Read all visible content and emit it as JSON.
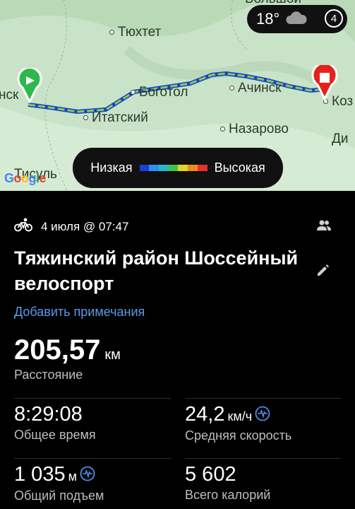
{
  "map": {
    "cities": {
      "tyukhtet": "Тюхтет",
      "bogotol": "Боготол",
      "achinsk": "Ачинск",
      "itatsky": "Итатский",
      "nazarovo": "Назарово",
      "koz": "Коз",
      "nsk": "нск",
      "di": "Ди",
      "tisul": "Тисуль",
      "bolshoy": "Большой"
    },
    "weather": {
      "temp": "18°",
      "aqi": "4"
    },
    "legend": {
      "low": "Низкая",
      "high": "Высокая",
      "colors": [
        "#1a3fd6",
        "#2f8ff0",
        "#28b8c8",
        "#3fc24a",
        "#e3d528",
        "#f08a1e",
        "#e3342c"
      ]
    },
    "attribution": "Google",
    "route_color": "#3a6ad8"
  },
  "activity": {
    "date": "4 июля @ 07:47",
    "title": "Тяжинский район Шоссейный велоспорт",
    "add_note": "Добавить примечания",
    "distance": {
      "value": "205,57",
      "unit": "км",
      "label": "Расстояние"
    },
    "stats": {
      "total_time": {
        "value": "8:29:08",
        "label": "Общее время"
      },
      "avg_speed": {
        "value": "24,2",
        "unit": "км/ч",
        "label": "Средняя скорость"
      },
      "ascent": {
        "value": "1 035",
        "unit": "м",
        "label": "Общий подъем"
      },
      "calories": {
        "value": "5 602",
        "label": "Всего калорий"
      }
    }
  },
  "icons": [
    "bicycle-icon",
    "group-icon",
    "edit-icon",
    "pulse-icon",
    "cloud-icon",
    "start-pin-icon",
    "finish-pin-icon"
  ]
}
